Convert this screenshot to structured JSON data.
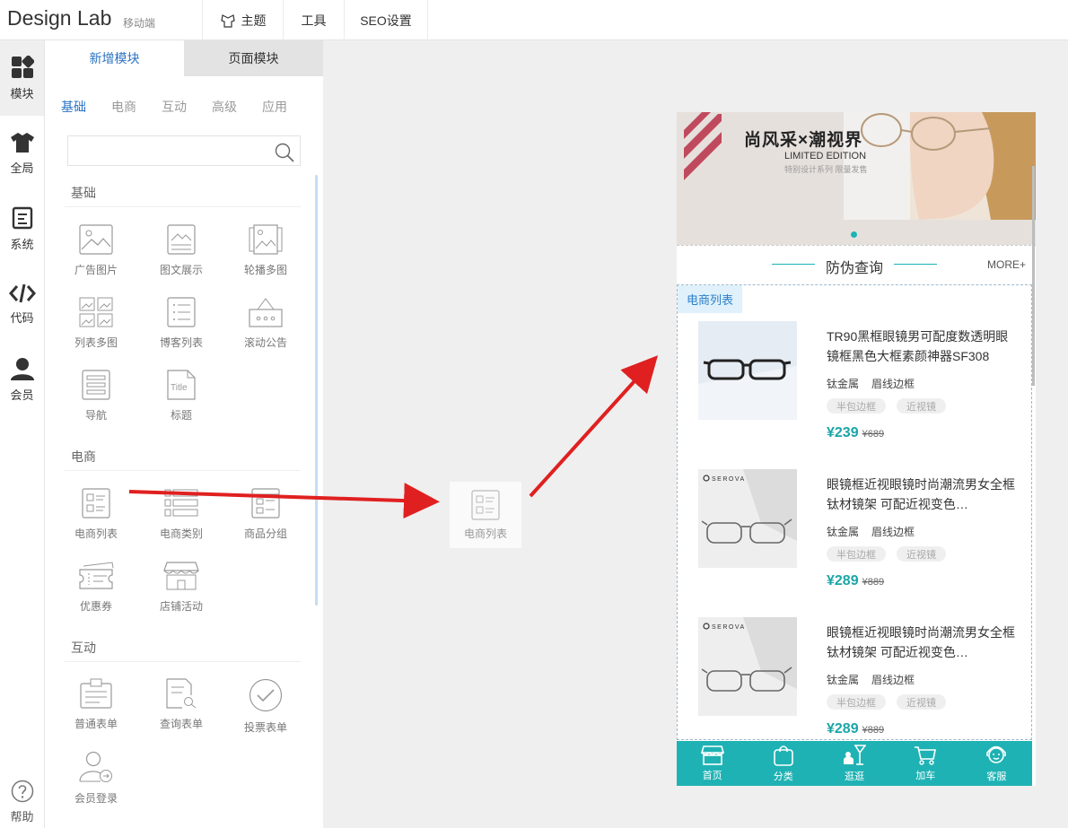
{
  "topbar": {
    "brand": "Design Lab",
    "mobile_label": "移动端",
    "nav": [
      {
        "label": "主题",
        "icon": "theme-icon"
      },
      {
        "label": "工具"
      },
      {
        "label": "SEO设置"
      }
    ]
  },
  "rail": {
    "items": [
      "模块",
      "全局",
      "系统",
      "代码",
      "会员"
    ],
    "help": "帮助"
  },
  "panel": {
    "tabs": [
      "新增模块",
      "页面模块"
    ],
    "subtabs": [
      "基础",
      "电商",
      "互动",
      "高级",
      "应用"
    ],
    "search_placeholder": "",
    "sections": {
      "basic": {
        "title": "基础",
        "modules": [
          "广告图片",
          "图文展示",
          "轮播多图",
          "列表多图",
          "博客列表",
          "滚动公告",
          "导航",
          "标题"
        ]
      },
      "ecommerce": {
        "title": "电商",
        "modules": [
          "电商列表",
          "电商类别",
          "商品分组",
          "优惠券",
          "店铺活动"
        ]
      },
      "interactive": {
        "title": "互动",
        "modules": [
          "普通表单",
          "查询表单",
          "投票表单",
          "会员登录"
        ]
      }
    },
    "title_icon_text": "Title"
  },
  "drag_ghost": {
    "label": "电商列表"
  },
  "preview": {
    "banner": {
      "headline": "尚风采×潮视界",
      "edition": "LIMITED EDITION",
      "subline": "特别设计系列 限量发售"
    },
    "query": {
      "title": "防伪查询",
      "more": "MORE+"
    },
    "list_tag": "电商列表",
    "products": [
      {
        "title": "TR90黑框眼镜男可配度数透明眼镜框黑色大框素颜神器SF308",
        "meta": [
          "钛金属",
          "眉线边框"
        ],
        "tags": [
          "半包边框",
          "近视镜"
        ],
        "price": "¥239",
        "original": "¥689",
        "brand": ""
      },
      {
        "title": "眼镜框近视眼镜时尚潮流男女全框钛材镜架 可配近视变色…",
        "meta": [
          "钛金属",
          "眉线边框"
        ],
        "tags": [
          "半包边框",
          "近视镜"
        ],
        "price": "¥289",
        "original": "¥889",
        "brand": "SEROVA"
      },
      {
        "title": "眼镜框近视眼镜时尚潮流男女全框钛材镜架 可配近视变色…",
        "meta": [
          "钛金属",
          "眉线边框"
        ],
        "tags": [
          "半包边框",
          "近视镜"
        ],
        "price": "¥289",
        "original": "¥889",
        "brand": "SEROVA"
      }
    ],
    "bottom_nav": [
      {
        "label": "首页",
        "icon": "store-icon"
      },
      {
        "label": "分类",
        "icon": "bag-icon"
      },
      {
        "label": "逛逛",
        "icon": "stroll-icon"
      },
      {
        "label": "加车",
        "icon": "cart-icon"
      },
      {
        "label": "客服",
        "icon": "service-icon"
      }
    ]
  },
  "colors": {
    "accent_blue": "#2b73c2",
    "teal": "#1fb2b4",
    "arrow_red": "#e02020"
  }
}
